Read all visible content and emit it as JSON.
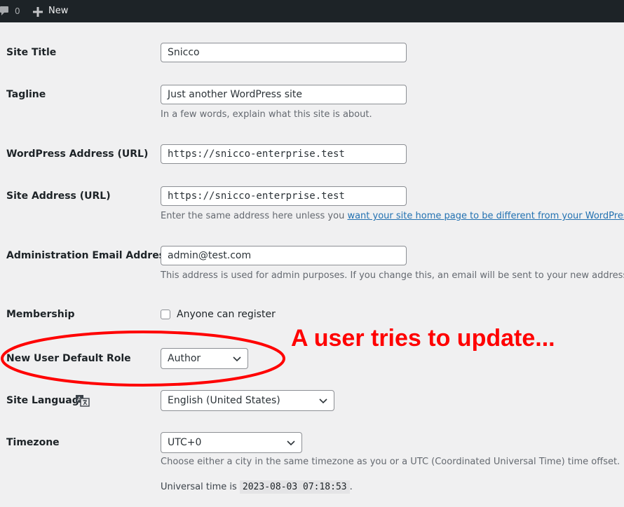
{
  "adminbar": {
    "comment_count": "0",
    "new_label": "New"
  },
  "fields": {
    "site_title": {
      "label": "Site Title",
      "value": "Snicco"
    },
    "tagline": {
      "label": "Tagline",
      "value": "Just another WordPress site",
      "description": "In a few words, explain what this site is about."
    },
    "wp_address": {
      "label": "WordPress Address (URL)",
      "value": "https://snicco-enterprise.test"
    },
    "site_address": {
      "label": "Site Address (URL)",
      "value": "https://snicco-enterprise.test",
      "description_prefix": "Enter the same address here unless you ",
      "description_link": "want your site home page to be different from your WordPress i"
    },
    "admin_email": {
      "label": "Administration Email Address",
      "value": "admin@test.com",
      "description": "This address is used for admin purposes. If you change this, an email will be sent to your new address to c"
    },
    "membership": {
      "label": "Membership",
      "checkbox_label": "Anyone can register",
      "checked": false
    },
    "default_role": {
      "label": "New User Default Role",
      "value": "Author"
    },
    "site_language": {
      "label": "Site Language",
      "value": "English (United States)"
    },
    "timezone": {
      "label": "Timezone",
      "value": "UTC+0",
      "description": "Choose either a city in the same timezone as you or a UTC (Coordinated Universal Time) time offset.",
      "universal_prefix": "Universal time is ",
      "universal_time": "2023-08-03 07:18:53",
      "universal_suffix": "."
    }
  },
  "annotation": {
    "text": "A user tries to update...",
    "color": "#ff0000"
  },
  "colors": {
    "adminbar_bg": "#1d2327",
    "page_bg": "#f0f0f1",
    "link": "#2271b1"
  }
}
